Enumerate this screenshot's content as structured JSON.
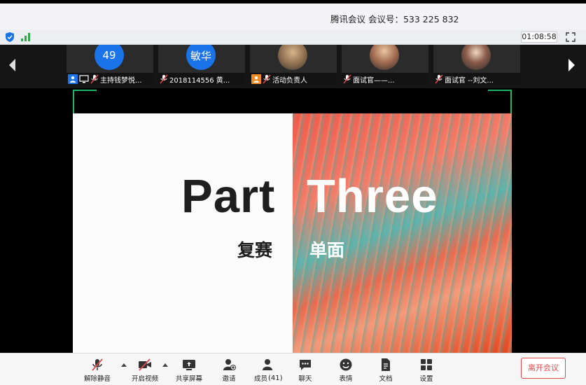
{
  "window": {
    "title": "腾讯会议  会议号：533 225 832"
  },
  "status": {
    "timer": "01:08:58"
  },
  "participants": [
    {
      "avatar_text": "49",
      "name": "主持钱梦悦..."
    },
    {
      "avatar_text": "敏华",
      "name": "2018114556 黄..."
    },
    {
      "avatar_text": "",
      "name": "活动负责人"
    },
    {
      "avatar_text": "",
      "name": "面试官——..."
    },
    {
      "avatar_text": "",
      "name": "面试官 --刘文..."
    }
  ],
  "slide": {
    "word_left": "Part",
    "word_right": "Three",
    "sub_left": "复赛",
    "sub_right": "单面"
  },
  "toolbar": {
    "unmute": "解除静音",
    "start_video": "开启视频",
    "share_screen": "共享屏幕",
    "invite": "邀请",
    "members": "成员",
    "members_count": "(41)",
    "chat": "聊天",
    "reactions": "表情",
    "docs": "文档",
    "settings": "设置",
    "leave": "离开会议"
  },
  "colors": {
    "accent": "#1a73e8",
    "danger": "#e24a4a",
    "frame": "#1fb46a"
  }
}
